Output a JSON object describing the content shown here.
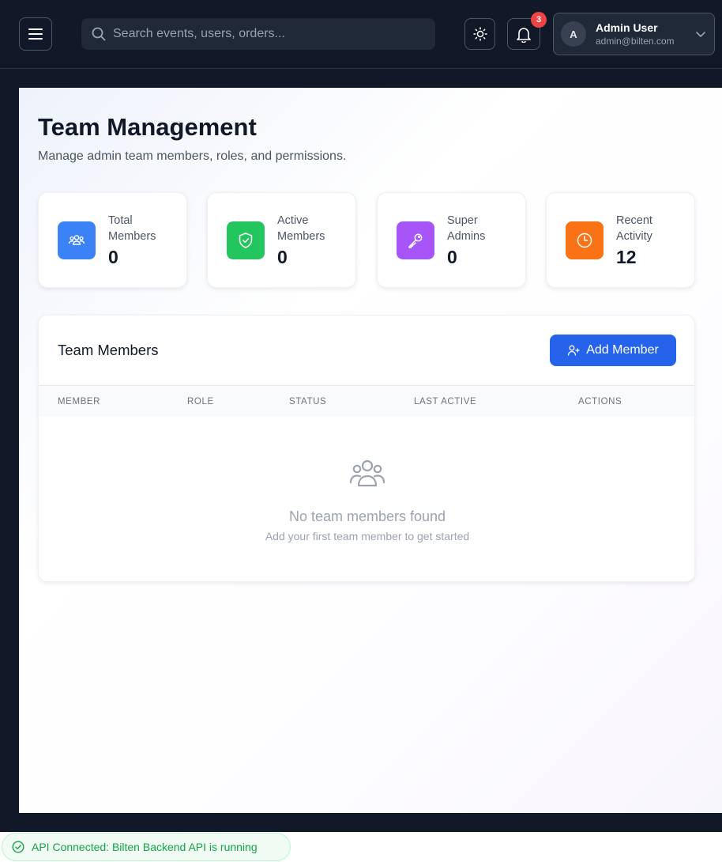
{
  "header": {
    "search_placeholder": "Search events, users, orders...",
    "notification_count": "3",
    "user": {
      "initial": "A",
      "name": "Admin User",
      "email": "admin@bilten.com"
    }
  },
  "page": {
    "title": "Team Management",
    "subtitle": "Manage admin team members, roles, and permissions."
  },
  "stats": [
    {
      "label": "Total Members",
      "value": "0",
      "color": "#3b82f6",
      "icon": "users-icon"
    },
    {
      "label": "Active Members",
      "value": "0",
      "color": "#22c55e",
      "icon": "shield-check-icon"
    },
    {
      "label": "Super Admins",
      "value": "0",
      "color": "#a855f7",
      "icon": "key-icon"
    },
    {
      "label": "Recent Activity",
      "value": "12",
      "color": "#f97316",
      "icon": "clock-icon"
    }
  ],
  "members": {
    "title": "Team Members",
    "add_button": "Add Member",
    "columns": [
      "MEMBER",
      "ROLE",
      "STATUS",
      "LAST ACTIVE",
      "ACTIONS"
    ],
    "empty_title": "No team members found",
    "empty_subtitle": "Add your first team member to get started"
  },
  "api_status": "API Connected: Bilten Backend API is running",
  "colors": {
    "accent": "#2563eb",
    "sidebar_bg": "#111827",
    "success": "#16a34a",
    "badge": "#ef4444"
  }
}
